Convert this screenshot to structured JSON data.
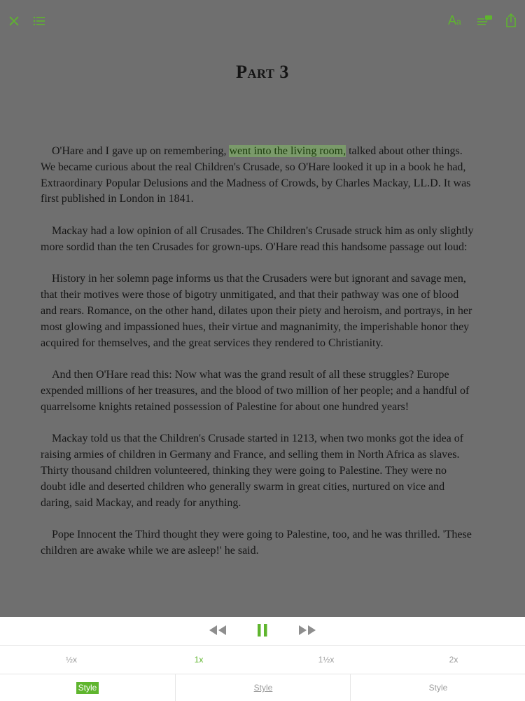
{
  "app": {
    "accent": "#5fb52e"
  },
  "toolbar": {
    "close_icon": "close-icon",
    "toc_icon": "list-icon",
    "font_icon_text": "A",
    "font_icon_small": "a",
    "speech_icon": "speech-icon",
    "share_icon": "share-icon"
  },
  "page": {
    "title": "Part 3",
    "p1_before": "O'Hare and I gave up on remembering, ",
    "p1_highlight": "went into the living room,",
    "p1_after": " talked about other things. We became curious about the real Children's Crusade, so O'Hare looked it up in a book he had, Extraordinary Popular Delusions and the Madness of Crowds, by Charles Mackay, LL.D. It was first published in London in 1841.",
    "p2": "Mackay had a low opinion of all Crusades. The Children's Crusade struck him as only slightly more sordid than the ten Crusades for grown-ups. O'Hare read this handsome passage out loud:",
    "p3": "History in her solemn page informs us that the Crusaders were but ignorant and savage men, that their motives were those of bigotry unmitigated, and that their pathway was one of blood and rears. Romance, on the other hand, dilates upon their piety and heroism, and portrays, in her most glowing and impassioned hues, their virtue and magnanimity, the imperishable honor they acquired for themselves, and the great services they rendered to Christianity.",
    "p4": "And then O'Hare read this: Now what was the grand result of all these struggles? Europe expended millions of her treasures, and the blood of two million of her people; and a handful of quarrelsome knights retained possession of Palestine for about one hundred years!",
    "p5": "Mackay told us that the Children's Crusade started in 1213, when two monks got the idea of raising armies of children in Germany and France, and selling them in North Africa as slaves. Thirty thousand children volunteered, thinking they were going to Palestine. They were no doubt idle and deserted children who generally swarm in great cities, nurtured on vice and daring, said Mackay, and ready for anything.",
    "p6": "Pope Innocent the Third thought they were going to Palestine, too, and he was thrilled. 'These children are awake while we are asleep!' he said."
  },
  "audio": {
    "rewind_icon": "rewind-icon",
    "pause_icon": "pause-icon",
    "forward_icon": "fast-forward-icon",
    "speeds": [
      "½x",
      "1x",
      "1½x",
      "2x"
    ],
    "active_speed": "1x",
    "styles": [
      "Style",
      "Style",
      "Style"
    ]
  }
}
